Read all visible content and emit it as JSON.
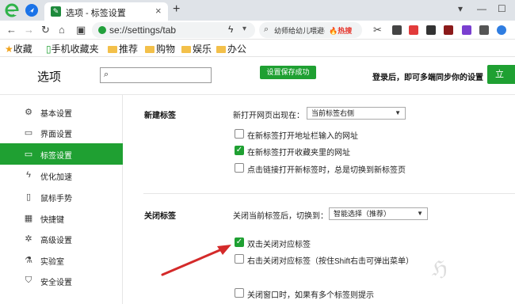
{
  "browser": {
    "tab_title": "选项 - 标签设置",
    "tab_close": "×",
    "new_tab": "+",
    "win_min": "—",
    "win_max": "☐",
    "address": "se://settings/tab",
    "search_text": "幼师给幼儿喂避孕",
    "search_hot": "🔥热搜"
  },
  "bookmarks": [
    {
      "label": "收藏",
      "icon": "star-icon"
    },
    {
      "label": "手机收藏夹",
      "icon": "phone-icon"
    },
    {
      "label": "推荐",
      "icon": "folder-icon"
    },
    {
      "label": "购物",
      "icon": "folder-icon"
    },
    {
      "label": "娱乐",
      "icon": "folder-icon"
    },
    {
      "label": "办公",
      "icon": "folder-icon"
    }
  ],
  "header": {
    "title": "选项",
    "saved_badge": "设置保存成功",
    "login_tip": "登录后，即可多端同步你的设置",
    "login_button": "立"
  },
  "sidebar": {
    "items": [
      {
        "label": "基本设置",
        "icon": "gear-icon",
        "glyph": "⚙"
      },
      {
        "label": "界面设置",
        "icon": "window-icon",
        "glyph": "▭"
      },
      {
        "label": "标签设置",
        "icon": "tab-icon",
        "glyph": "▭",
        "active": true
      },
      {
        "label": "优化加速",
        "icon": "bolt-icon",
        "glyph": "ϟ"
      },
      {
        "label": "鼠标手势",
        "icon": "mouse-icon",
        "glyph": "▯"
      },
      {
        "label": "快捷键",
        "icon": "keyboard-icon",
        "glyph": "▦"
      },
      {
        "label": "高级设置",
        "icon": "settings-icon",
        "glyph": "✲"
      },
      {
        "label": "实验室",
        "icon": "lab-icon",
        "glyph": "⚗"
      },
      {
        "label": "安全设置",
        "icon": "shield-icon",
        "glyph": "⛉"
      }
    ]
  },
  "new_tab_section": {
    "title": "新建标签",
    "open_label": "新打开网页出现在：",
    "open_select": "当前标签右侧",
    "options": [
      {
        "label": "在新标签打开地址栏输入的网址",
        "checked": false
      },
      {
        "label": "在新标签打开收藏夹里的网址",
        "checked": true
      },
      {
        "label": "点击链接打开新标签时，总是切换到新标签页",
        "checked": false
      }
    ]
  },
  "close_tab_section": {
    "title": "关闭标签",
    "switch_label": "关闭当前标签后，切换到：",
    "switch_select": "智能选择（推荐）",
    "options": [
      {
        "label": "双击关闭对应标签",
        "checked": true
      },
      {
        "label": "右击关闭对应标签（按住Shift右击可弹出菜单）",
        "checked": false
      },
      {
        "label": "关闭窗口时，如果有多个标签则提示",
        "checked": false
      }
    ]
  },
  "colors": {
    "accent": "#1fa032",
    "annotation_arrow": "#d42a2a"
  },
  "watermark": "ℌ"
}
